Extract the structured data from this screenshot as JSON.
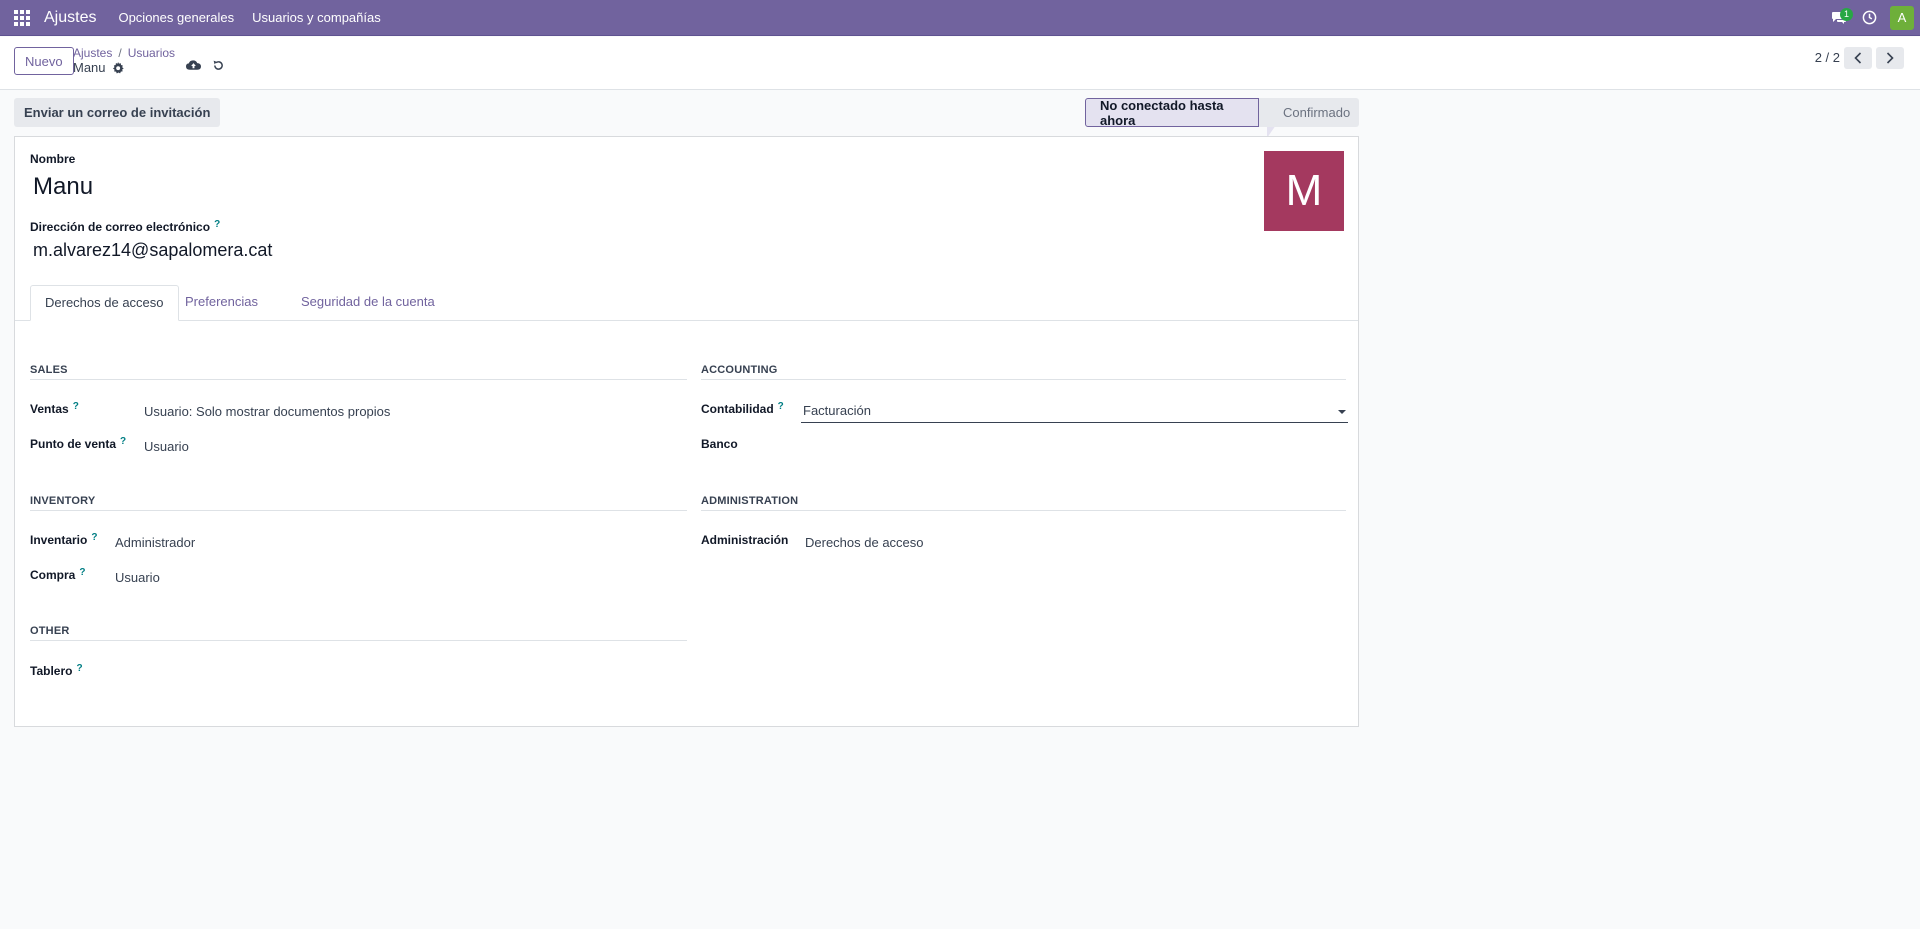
{
  "navbar": {
    "app_name": "Ajustes",
    "menu": [
      "Opciones generales",
      "Usuarios y compañías"
    ],
    "chat_count": "1",
    "user_initial": "A"
  },
  "control": {
    "new_label": "Nuevo",
    "breadcrumb": [
      "Ajustes",
      "Usuarios"
    ],
    "breadcrumb_sep": "/",
    "record_name": "Manu",
    "pager": "2 / 2"
  },
  "actions": {
    "invite_label": "Enviar un correo de invitación"
  },
  "statusbar": {
    "active": "No conectado hasta ahora",
    "next": "Confirmado"
  },
  "form": {
    "name_label": "Nombre",
    "name_value": "Manu",
    "email_label": "Dirección de correo electrónico",
    "email_value": "m.alvarez14@sapalomera.cat",
    "avatar_letter": "M",
    "help_mark": "?"
  },
  "tabs": [
    "Derechos de acceso",
    "Preferencias",
    "Seguridad de la cuenta"
  ],
  "groups": {
    "sales": {
      "title": "SALES",
      "ventas_label": "Ventas",
      "ventas_value": "Usuario: Solo mostrar documentos propios",
      "pos_label": "Punto de venta",
      "pos_value": "Usuario"
    },
    "accounting": {
      "title": "ACCOUNTING",
      "contabilidad_label": "Contabilidad",
      "contabilidad_value": "Facturación",
      "banco_label": "Banco"
    },
    "inventory": {
      "title": "INVENTORY",
      "inventario_label": "Inventario",
      "inventario_value": "Administrador",
      "compra_label": "Compra",
      "compra_value": "Usuario"
    },
    "administration": {
      "title": "ADMINISTRATION",
      "admin_label": "Administración",
      "admin_value": "Derechos de acceso"
    },
    "other": {
      "title": "OTHER",
      "tablero_label": "Tablero"
    }
  },
  "colors": {
    "brand": "#71639e",
    "avatar_bg": "#a4395f",
    "help": "#017e84",
    "user_avatar": "#6eaf3a"
  }
}
